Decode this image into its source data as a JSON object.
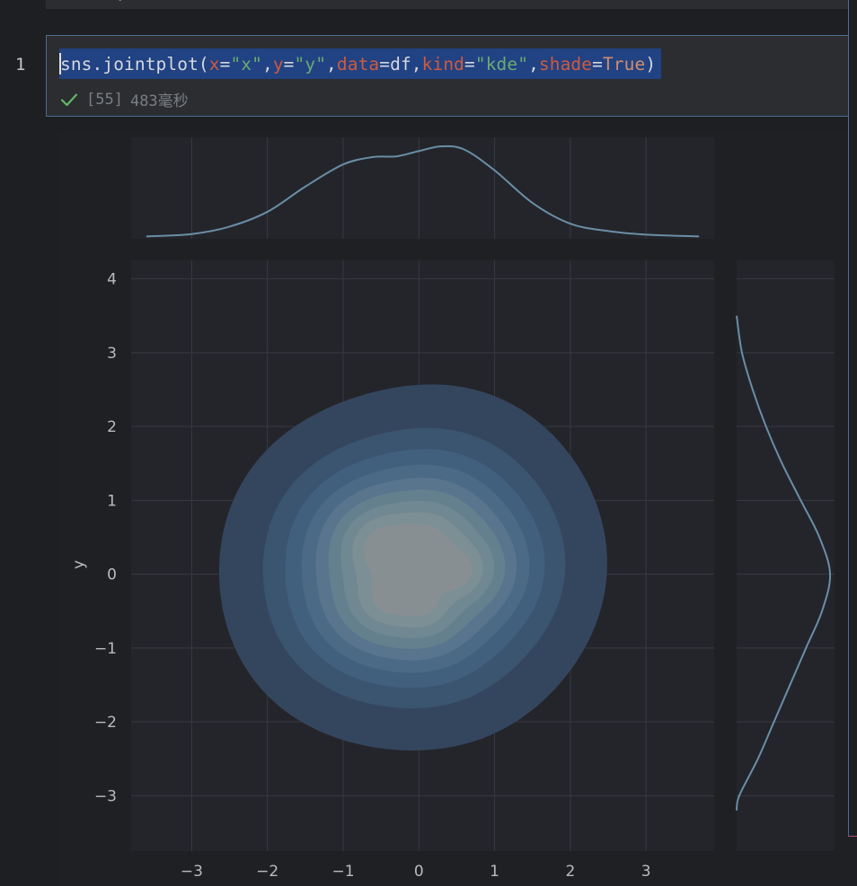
{
  "editor": {
    "line_number": "1",
    "code_tokens": [
      {
        "text": "sns.jointplot(",
        "kind": "fn"
      },
      {
        "text": "x",
        "kind": "param"
      },
      {
        "text": "=",
        "kind": "fn"
      },
      {
        "text": "\"x\"",
        "kind": "str"
      },
      {
        "text": ",",
        "kind": "fn"
      },
      {
        "text": "y",
        "kind": "param"
      },
      {
        "text": "=",
        "kind": "fn"
      },
      {
        "text": "\"y\"",
        "kind": "str"
      },
      {
        "text": ",",
        "kind": "fn"
      },
      {
        "text": "data",
        "kind": "param"
      },
      {
        "text": "=df,",
        "kind": "fn"
      },
      {
        "text": "kind",
        "kind": "param"
      },
      {
        "text": "=",
        "kind": "fn"
      },
      {
        "text": "\"kde\"",
        "kind": "str"
      },
      {
        "text": ",",
        "kind": "fn"
      },
      {
        "text": "shade",
        "kind": "param"
      },
      {
        "text": "=",
        "kind": "fn"
      },
      {
        "text": "True",
        "kind": "kw"
      },
      {
        "text": ")",
        "kind": "fn"
      }
    ],
    "exec_count": "[55]",
    "exec_time": "483毫秒",
    "status_icon": "check-icon"
  },
  "colors": {
    "selection": "#214283",
    "line_color": "#6a8ea6",
    "kde_levels": [
      "#34465e",
      "#3b5470",
      "#41607e",
      "#4a6a86",
      "#58758d",
      "#64808f",
      "#708891",
      "#7c8f95",
      "#888f93"
    ],
    "plot_bg": "#24252b",
    "grid": "#383942"
  },
  "chart_data": {
    "type": "kde-jointplot",
    "xlabel": "",
    "ylabel": "y",
    "xticks": [
      -3,
      -2,
      -1,
      0,
      1,
      2,
      3
    ],
    "yticks": [
      -3,
      -2,
      -1,
      0,
      1,
      2,
      3,
      4
    ],
    "xlim": [
      -3.8,
      3.9
    ],
    "ylim": [
      -3.75,
      4.25
    ],
    "grid": true,
    "joint_kde": {
      "components": [
        {
          "mean": [
            -0.6,
            0.0
          ],
          "sd": [
            0.85,
            0.9
          ],
          "weight": 0.45
        },
        {
          "mean": [
            0.35,
            0.15
          ],
          "sd": [
            0.85,
            0.95
          ],
          "weight": 0.55
        }
      ],
      "levels": 9
    },
    "marginal_x": {
      "x": [
        -3.6,
        -3.0,
        -2.5,
        -2.0,
        -1.5,
        -1.0,
        -0.6,
        -0.3,
        0.0,
        0.3,
        0.6,
        1.0,
        1.5,
        2.0,
        2.5,
        3.0,
        3.7
      ],
      "density": [
        0.002,
        0.01,
        0.035,
        0.085,
        0.17,
        0.245,
        0.27,
        0.272,
        0.29,
        0.306,
        0.295,
        0.225,
        0.115,
        0.045,
        0.02,
        0.008,
        0.002
      ]
    },
    "marginal_y": {
      "y": [
        -3.2,
        -3.0,
        -2.5,
        -2.0,
        -1.5,
        -1.0,
        -0.5,
        0.0,
        0.5,
        1.0,
        1.5,
        2.0,
        2.5,
        3.0,
        3.5
      ],
      "density": [
        0.0,
        0.01,
        0.08,
        0.14,
        0.2,
        0.26,
        0.32,
        0.35,
        0.31,
        0.24,
        0.17,
        0.11,
        0.06,
        0.02,
        0.0
      ]
    }
  }
}
